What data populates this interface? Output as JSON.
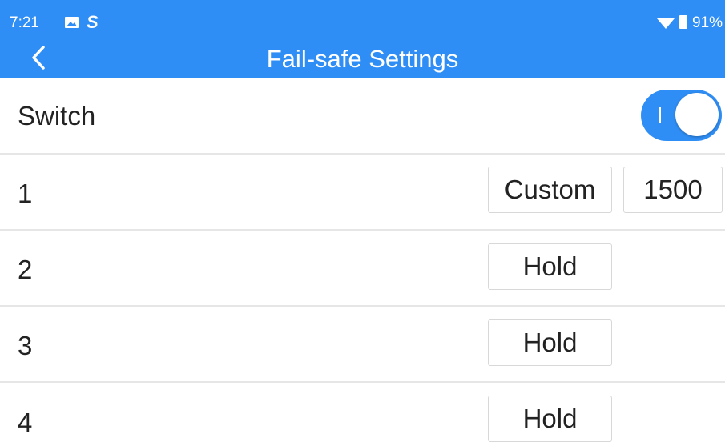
{
  "status_bar": {
    "time": "7:21",
    "icons": [
      "image-icon",
      "s-app-icon",
      "wifi-icon",
      "battery-icon"
    ],
    "battery": "91%"
  },
  "header": {
    "title": "Fail-safe Settings",
    "back_icon": "chevron-left-icon",
    "color": "#2f8ef5"
  },
  "settings": {
    "switch": {
      "label": "Switch",
      "enabled": true,
      "on_color": "#2f8ef5"
    },
    "channels": [
      {
        "label": "1",
        "mode": "Custom",
        "value": "1500"
      },
      {
        "label": "2",
        "mode": "Hold"
      },
      {
        "label": "3",
        "mode": "Hold"
      },
      {
        "label": "4",
        "mode": "Hold"
      }
    ]
  }
}
